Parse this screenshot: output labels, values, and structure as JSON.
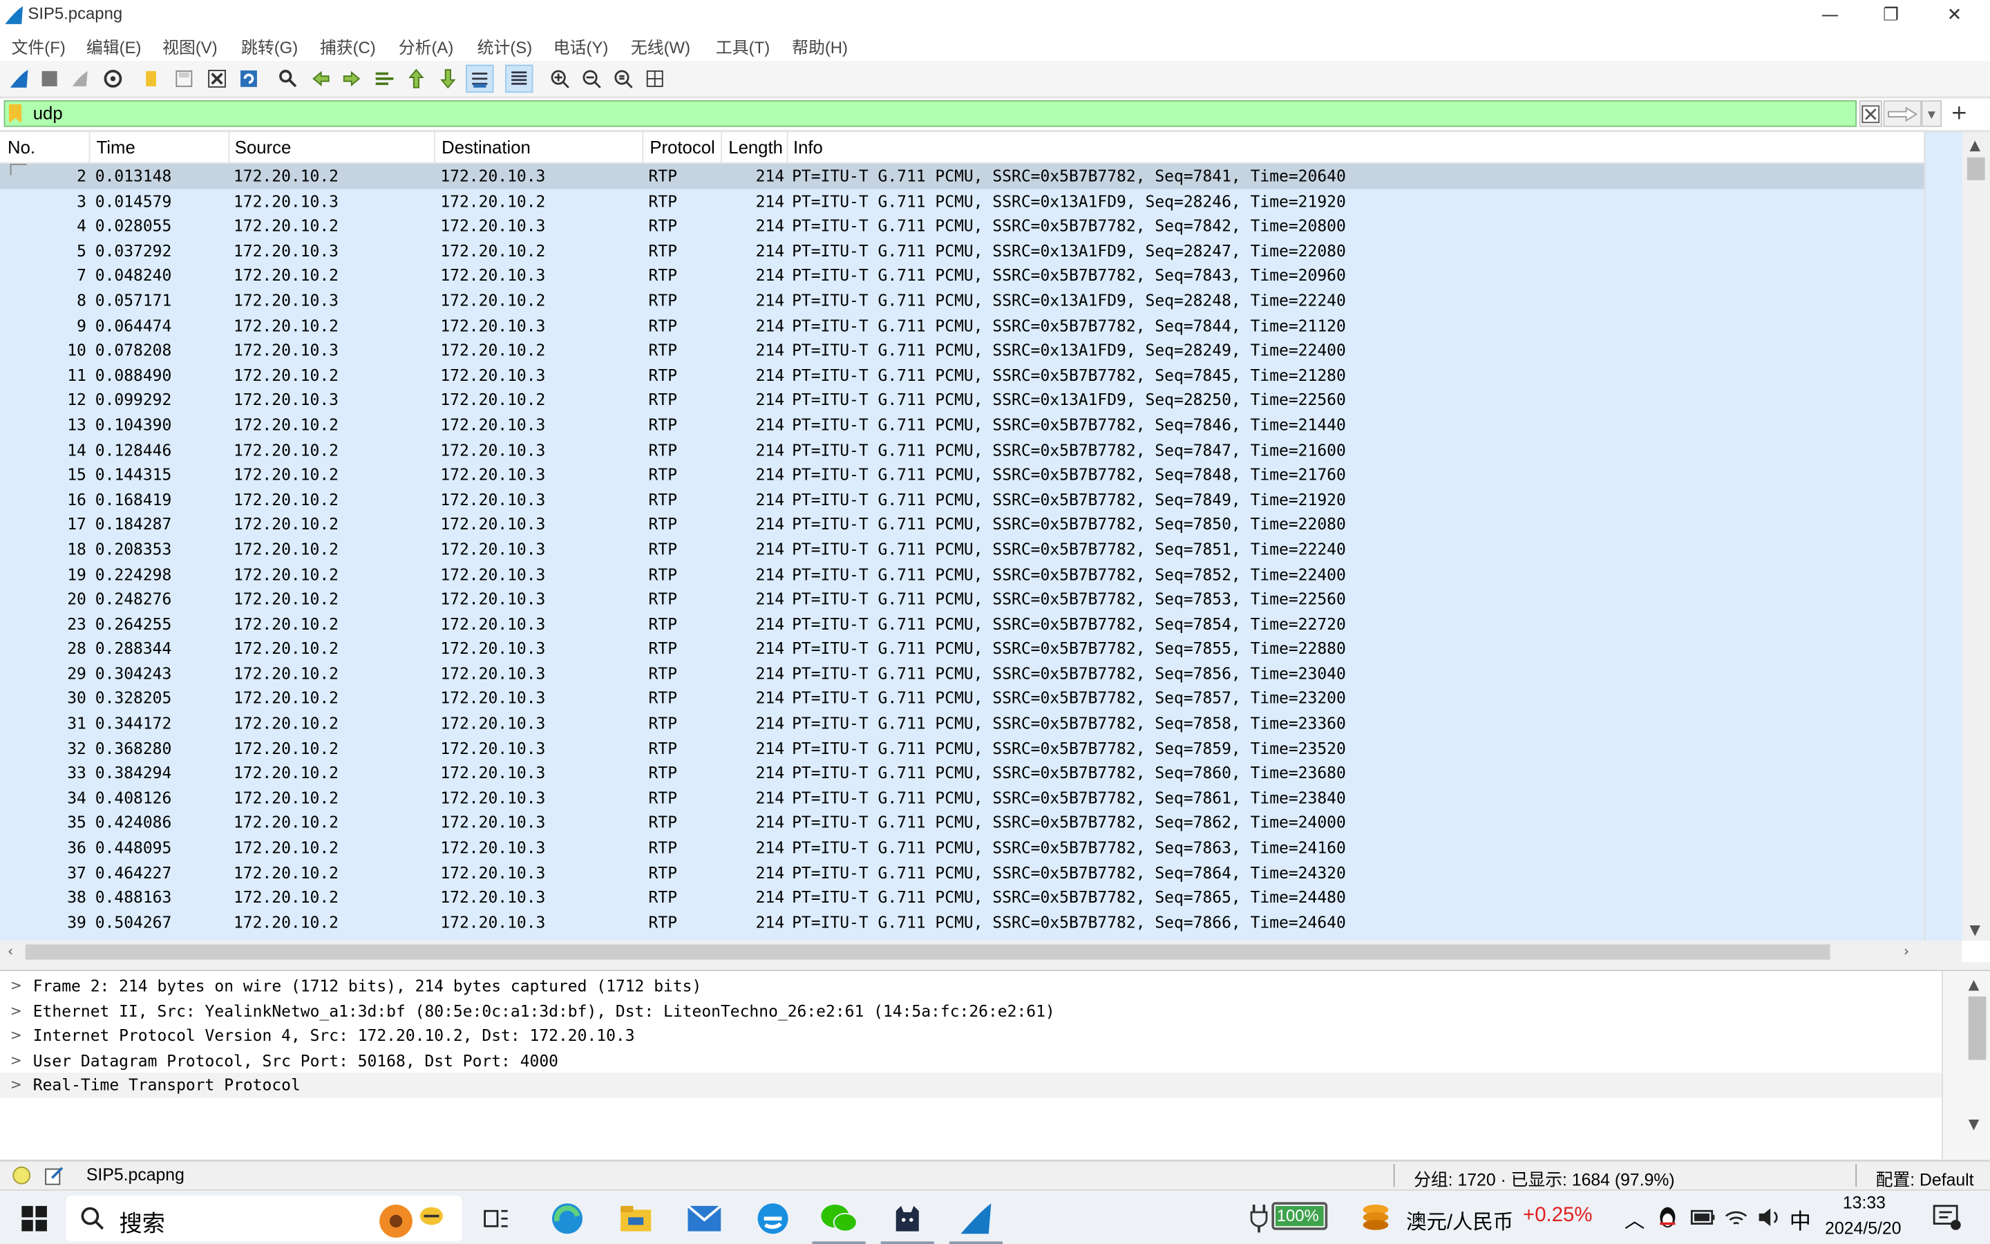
{
  "window": {
    "title": "SIP5.pcapng",
    "minimize": "—",
    "restore": "❐",
    "close": "✕"
  },
  "menu": [
    "文件(F)",
    "编辑(E)",
    "视图(V)",
    "跳转(G)",
    "捕获(C)",
    "分析(A)",
    "统计(S)",
    "电话(Y)",
    "无线(W)",
    "工具(T)",
    "帮助(H)"
  ],
  "filter": {
    "value": "udp",
    "add": "+"
  },
  "columns": {
    "no": "No.",
    "time": "Time",
    "source": "Source",
    "destination": "Destination",
    "protocol": "Protocol",
    "length": "Length",
    "info": "Info"
  },
  "packets": [
    {
      "no": "2",
      "time": "0.013148",
      "src": "172.20.10.2",
      "dst": "172.20.10.3",
      "proto": "RTP",
      "len": "214",
      "info": "PT=ITU-T G.711 PCMU, SSRC=0x5B7B7782, Seq=7841, Time=20640"
    },
    {
      "no": "3",
      "time": "0.014579",
      "src": "172.20.10.3",
      "dst": "172.20.10.2",
      "proto": "RTP",
      "len": "214",
      "info": "PT=ITU-T G.711 PCMU, SSRC=0x13A1FD9, Seq=28246, Time=21920"
    },
    {
      "no": "4",
      "time": "0.028055",
      "src": "172.20.10.2",
      "dst": "172.20.10.3",
      "proto": "RTP",
      "len": "214",
      "info": "PT=ITU-T G.711 PCMU, SSRC=0x5B7B7782, Seq=7842, Time=20800"
    },
    {
      "no": "5",
      "time": "0.037292",
      "src": "172.20.10.3",
      "dst": "172.20.10.2",
      "proto": "RTP",
      "len": "214",
      "info": "PT=ITU-T G.711 PCMU, SSRC=0x13A1FD9, Seq=28247, Time=22080"
    },
    {
      "no": "7",
      "time": "0.048240",
      "src": "172.20.10.2",
      "dst": "172.20.10.3",
      "proto": "RTP",
      "len": "214",
      "info": "PT=ITU-T G.711 PCMU, SSRC=0x5B7B7782, Seq=7843, Time=20960"
    },
    {
      "no": "8",
      "time": "0.057171",
      "src": "172.20.10.3",
      "dst": "172.20.10.2",
      "proto": "RTP",
      "len": "214",
      "info": "PT=ITU-T G.711 PCMU, SSRC=0x13A1FD9, Seq=28248, Time=22240"
    },
    {
      "no": "9",
      "time": "0.064474",
      "src": "172.20.10.2",
      "dst": "172.20.10.3",
      "proto": "RTP",
      "len": "214",
      "info": "PT=ITU-T G.711 PCMU, SSRC=0x5B7B7782, Seq=7844, Time=21120"
    },
    {
      "no": "10",
      "time": "0.078208",
      "src": "172.20.10.3",
      "dst": "172.20.10.2",
      "proto": "RTP",
      "len": "214",
      "info": "PT=ITU-T G.711 PCMU, SSRC=0x13A1FD9, Seq=28249, Time=22400"
    },
    {
      "no": "11",
      "time": "0.088490",
      "src": "172.20.10.2",
      "dst": "172.20.10.3",
      "proto": "RTP",
      "len": "214",
      "info": "PT=ITU-T G.711 PCMU, SSRC=0x5B7B7782, Seq=7845, Time=21280"
    },
    {
      "no": "12",
      "time": "0.099292",
      "src": "172.20.10.3",
      "dst": "172.20.10.2",
      "proto": "RTP",
      "len": "214",
      "info": "PT=ITU-T G.711 PCMU, SSRC=0x13A1FD9, Seq=28250, Time=22560"
    },
    {
      "no": "13",
      "time": "0.104390",
      "src": "172.20.10.2",
      "dst": "172.20.10.3",
      "proto": "RTP",
      "len": "214",
      "info": "PT=ITU-T G.711 PCMU, SSRC=0x5B7B7782, Seq=7846, Time=21440"
    },
    {
      "no": "14",
      "time": "0.128446",
      "src": "172.20.10.2",
      "dst": "172.20.10.3",
      "proto": "RTP",
      "len": "214",
      "info": "PT=ITU-T G.711 PCMU, SSRC=0x5B7B7782, Seq=7847, Time=21600"
    },
    {
      "no": "15",
      "time": "0.144315",
      "src": "172.20.10.2",
      "dst": "172.20.10.3",
      "proto": "RTP",
      "len": "214",
      "info": "PT=ITU-T G.711 PCMU, SSRC=0x5B7B7782, Seq=7848, Time=21760"
    },
    {
      "no": "16",
      "time": "0.168419",
      "src": "172.20.10.2",
      "dst": "172.20.10.3",
      "proto": "RTP",
      "len": "214",
      "info": "PT=ITU-T G.711 PCMU, SSRC=0x5B7B7782, Seq=7849, Time=21920"
    },
    {
      "no": "17",
      "time": "0.184287",
      "src": "172.20.10.2",
      "dst": "172.20.10.3",
      "proto": "RTP",
      "len": "214",
      "info": "PT=ITU-T G.711 PCMU, SSRC=0x5B7B7782, Seq=7850, Time=22080"
    },
    {
      "no": "18",
      "time": "0.208353",
      "src": "172.20.10.2",
      "dst": "172.20.10.3",
      "proto": "RTP",
      "len": "214",
      "info": "PT=ITU-T G.711 PCMU, SSRC=0x5B7B7782, Seq=7851, Time=22240"
    },
    {
      "no": "19",
      "time": "0.224298",
      "src": "172.20.10.2",
      "dst": "172.20.10.3",
      "proto": "RTP",
      "len": "214",
      "info": "PT=ITU-T G.711 PCMU, SSRC=0x5B7B7782, Seq=7852, Time=22400"
    },
    {
      "no": "20",
      "time": "0.248276",
      "src": "172.20.10.2",
      "dst": "172.20.10.3",
      "proto": "RTP",
      "len": "214",
      "info": "PT=ITU-T G.711 PCMU, SSRC=0x5B7B7782, Seq=7853, Time=22560"
    },
    {
      "no": "23",
      "time": "0.264255",
      "src": "172.20.10.2",
      "dst": "172.20.10.3",
      "proto": "RTP",
      "len": "214",
      "info": "PT=ITU-T G.711 PCMU, SSRC=0x5B7B7782, Seq=7854, Time=22720"
    },
    {
      "no": "28",
      "time": "0.288344",
      "src": "172.20.10.2",
      "dst": "172.20.10.3",
      "proto": "RTP",
      "len": "214",
      "info": "PT=ITU-T G.711 PCMU, SSRC=0x5B7B7782, Seq=7855, Time=22880"
    },
    {
      "no": "29",
      "time": "0.304243",
      "src": "172.20.10.2",
      "dst": "172.20.10.3",
      "proto": "RTP",
      "len": "214",
      "info": "PT=ITU-T G.711 PCMU, SSRC=0x5B7B7782, Seq=7856, Time=23040"
    },
    {
      "no": "30",
      "time": "0.328205",
      "src": "172.20.10.2",
      "dst": "172.20.10.3",
      "proto": "RTP",
      "len": "214",
      "info": "PT=ITU-T G.711 PCMU, SSRC=0x5B7B7782, Seq=7857, Time=23200"
    },
    {
      "no": "31",
      "time": "0.344172",
      "src": "172.20.10.2",
      "dst": "172.20.10.3",
      "proto": "RTP",
      "len": "214",
      "info": "PT=ITU-T G.711 PCMU, SSRC=0x5B7B7782, Seq=7858, Time=23360"
    },
    {
      "no": "32",
      "time": "0.368280",
      "src": "172.20.10.2",
      "dst": "172.20.10.3",
      "proto": "RTP",
      "len": "214",
      "info": "PT=ITU-T G.711 PCMU, SSRC=0x5B7B7782, Seq=7859, Time=23520"
    },
    {
      "no": "33",
      "time": "0.384294",
      "src": "172.20.10.2",
      "dst": "172.20.10.3",
      "proto": "RTP",
      "len": "214",
      "info": "PT=ITU-T G.711 PCMU, SSRC=0x5B7B7782, Seq=7860, Time=23680"
    },
    {
      "no": "34",
      "time": "0.408126",
      "src": "172.20.10.2",
      "dst": "172.20.10.3",
      "proto": "RTP",
      "len": "214",
      "info": "PT=ITU-T G.711 PCMU, SSRC=0x5B7B7782, Seq=7861, Time=23840"
    },
    {
      "no": "35",
      "time": "0.424086",
      "src": "172.20.10.2",
      "dst": "172.20.10.3",
      "proto": "RTP",
      "len": "214",
      "info": "PT=ITU-T G.711 PCMU, SSRC=0x5B7B7782, Seq=7862, Time=24000"
    },
    {
      "no": "36",
      "time": "0.448095",
      "src": "172.20.10.2",
      "dst": "172.20.10.3",
      "proto": "RTP",
      "len": "214",
      "info": "PT=ITU-T G.711 PCMU, SSRC=0x5B7B7782, Seq=7863, Time=24160"
    },
    {
      "no": "37",
      "time": "0.464227",
      "src": "172.20.10.2",
      "dst": "172.20.10.3",
      "proto": "RTP",
      "len": "214",
      "info": "PT=ITU-T G.711 PCMU, SSRC=0x5B7B7782, Seq=7864, Time=24320"
    },
    {
      "no": "38",
      "time": "0.488163",
      "src": "172.20.10.2",
      "dst": "172.20.10.3",
      "proto": "RTP",
      "len": "214",
      "info": "PT=ITU-T G.711 PCMU, SSRC=0x5B7B7782, Seq=7865, Time=24480"
    },
    {
      "no": "39",
      "time": "0.504267",
      "src": "172.20.10.2",
      "dst": "172.20.10.3",
      "proto": "RTP",
      "len": "214",
      "info": "PT=ITU-T G.711 PCMU, SSRC=0x5B7B7782, Seq=7866, Time=24640"
    }
  ],
  "details": [
    "Frame 2: 214 bytes on wire (1712 bits), 214 bytes captured (1712 bits)",
    "Ethernet II, Src: YealinkNetwo_a1:3d:bf (80:5e:0c:a1:3d:bf), Dst: LiteonTechno_26:e2:61 (14:5a:fc:26:e2:61)",
    "Internet Protocol Version 4, Src: 172.20.10.2, Dst: 172.20.10.3",
    "User Datagram Protocol, Src Port: 50168, Dst Port: 4000",
    "Real-Time Transport Protocol"
  ],
  "status": {
    "file": "SIP5.pcapng",
    "packets": "分组: 1720 · 已显示: 1684 (97.9%)",
    "profile": "配置: Default"
  },
  "taskbar": {
    "search": "搜索",
    "battery": "100%",
    "currency_pair": "澳元/人民币",
    "currency_change": "+0.25%",
    "ime": "中",
    "time": "13:33",
    "date": "2024/5/20"
  },
  "colors": {
    "rowBg": "#dcecfc",
    "selectedRow": "#c6d4e1",
    "filterGreen": "#afffaf",
    "currencyUp": "#e02020"
  }
}
